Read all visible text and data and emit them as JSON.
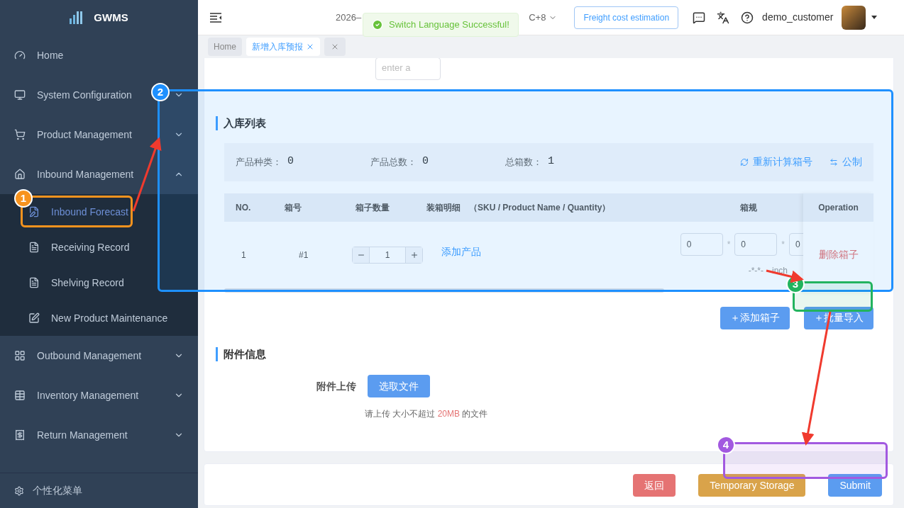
{
  "sidebar": {
    "logo": "GWMS",
    "items": [
      {
        "label": "Home",
        "kind": "link"
      },
      {
        "label": "System Configuration",
        "kind": "group",
        "expanded": false
      },
      {
        "label": "Product Management",
        "kind": "group",
        "expanded": false
      },
      {
        "label": "Inbound Management",
        "kind": "group",
        "expanded": true,
        "children": [
          {
            "label": "Inbound Forecast",
            "selected": true
          },
          {
            "label": "Receiving Record",
            "selected": false
          },
          {
            "label": "Shelving Record",
            "selected": false
          },
          {
            "label": "New Product Maintenance",
            "selected": false
          }
        ]
      },
      {
        "label": "Outbound Management",
        "kind": "group",
        "expanded": false
      },
      {
        "label": "Inventory Management",
        "kind": "group",
        "expanded": false
      },
      {
        "label": "Return Management",
        "kind": "group",
        "expanded": false
      }
    ],
    "footer": "个性化菜单"
  },
  "header": {
    "date": "2026–",
    "timezone": "C+8",
    "freight_button": "Freight cost estimation",
    "username": "demo_customer"
  },
  "toast": {
    "message": "Switch Language Successful!"
  },
  "tabs": [
    {
      "label": "Home",
      "selected": false,
      "closable": false
    },
    {
      "label": "新增入库预报",
      "selected": true,
      "closable": true
    }
  ],
  "remarks": {
    "placeholder": "enter a"
  },
  "inbound_list": {
    "title": "入库列表",
    "summary": [
      {
        "label": "产品种类：",
        "value": "0"
      },
      {
        "label": "产品总数：",
        "value": "0"
      },
      {
        "label": "总箱数：",
        "value": "1"
      }
    ],
    "actions": [
      "重新计算箱号",
      "公制"
    ],
    "columns": [
      "NO.",
      "箱号",
      "箱子数量",
      "装箱明细",
      "（SKU / Product Name / Quantity）",
      "箱规",
      "Operation"
    ],
    "rows": [
      {
        "no": "1",
        "box_no": "#1",
        "quantity": "1",
        "detail_link": "添加产品",
        "dims": [
          "0",
          "0",
          "0"
        ],
        "separator": "*",
        "dims_text": "-*-*-",
        "unit": "inch",
        "operation": "删除箱子"
      }
    ],
    "buttons": [
      "＋添加箱子",
      "＋批量导入"
    ]
  },
  "attachments": {
    "title": "附件信息",
    "label": "附件上传",
    "button": "选取文件",
    "hint_before": "请上传 大小不超过",
    "hint_highlight": "20MB",
    "hint_after": "的文件"
  },
  "footer_buttons": [
    {
      "label": "返回",
      "kind": "danger"
    },
    {
      "label": "Temporary Storage",
      "kind": "warning"
    },
    {
      "label": "Submit",
      "kind": "primary"
    }
  ],
  "annotations": [
    {
      "number": "1",
      "color": "#f7931e"
    },
    {
      "number": "2",
      "color": "#1e90ff"
    },
    {
      "number": "3",
      "color": "#22b35e"
    },
    {
      "number": "4",
      "color": "#a259e0"
    }
  ]
}
